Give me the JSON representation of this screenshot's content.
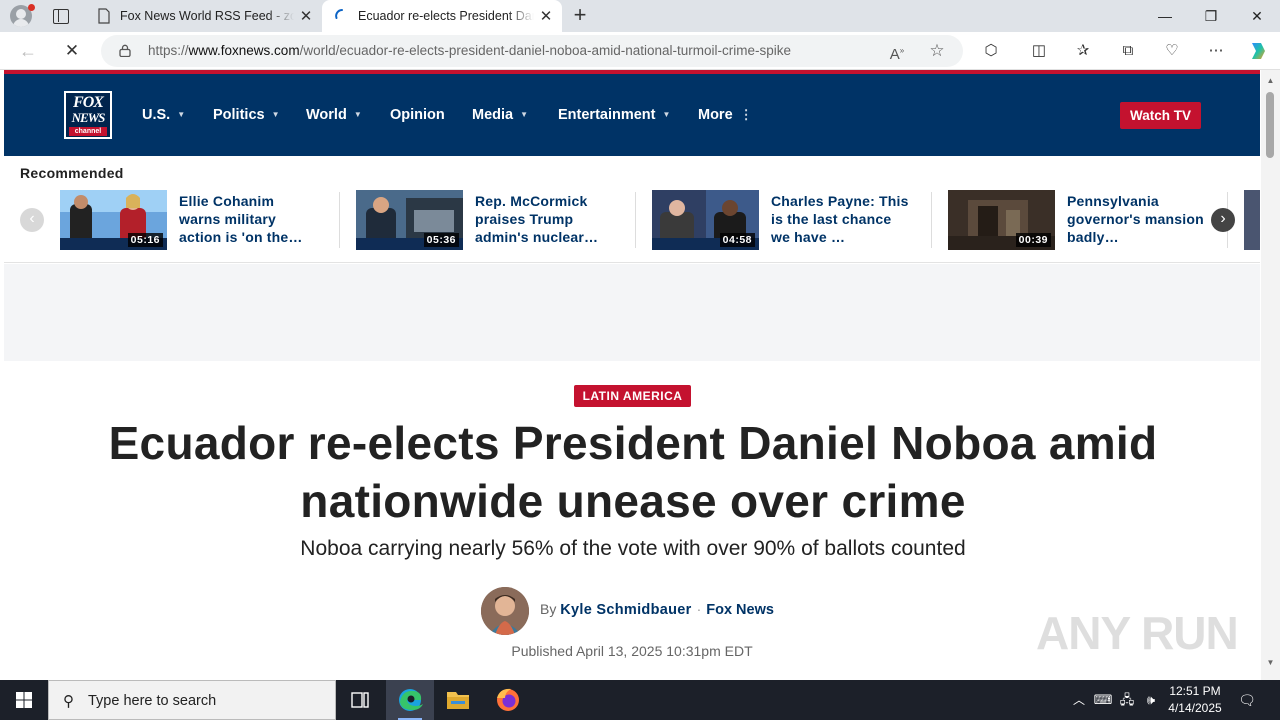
{
  "browser": {
    "tabs": [
      {
        "title": "Fox News World RSS Feed - zovel"
      },
      {
        "title": "Ecuador re-elects President Daniel Noboa"
      }
    ],
    "url_prefix": "https://",
    "url_host": "www.foxnews.com",
    "url_path": "/world/ecuador-re-elects-president-daniel-noboa-amid-national-turmoil-crime-spike"
  },
  "site": {
    "logo_line1": "FOX",
    "logo_line2": "NEWS",
    "logo_line3": "channel",
    "nav": [
      {
        "label": "U.S."
      },
      {
        "label": "Politics"
      },
      {
        "label": "World"
      },
      {
        "label": "Opinion"
      },
      {
        "label": "Media"
      },
      {
        "label": "Entertainment"
      },
      {
        "label": "More"
      }
    ],
    "watch_label": "Watch TV"
  },
  "recommended": {
    "heading": "Recommended",
    "items": [
      {
        "title": "Ellie Cohanim warns military action is 'on the…",
        "duration": "05:16"
      },
      {
        "title": "Rep. McCormick praises Trump admin's nuclear…",
        "duration": "05:36"
      },
      {
        "title": "Charles Payne: This is the last chance we have …",
        "duration": "04:58"
      },
      {
        "title": "Pennsylvania governor's mansion badly…",
        "duration": "00:39"
      }
    ]
  },
  "article": {
    "kicker": "LATIN AMERICA",
    "headline": "Ecuador re-elects President Daniel Noboa amid nationwide unease over crime",
    "subhead": "Noboa carrying nearly 56% of the vote with over 90% of ballots counted",
    "by": "By",
    "author": "Kyle Schmidbauer",
    "outlet": "Fox News",
    "published": "Published April 13, 2025 10:31pm EDT"
  },
  "watermark": "ANY RUN",
  "taskbar": {
    "search_placeholder": "Type here to search",
    "time": "12:51 PM",
    "date": "4/14/2025"
  },
  "colors": {
    "fox_navy": "#003366",
    "fox_red": "#c4122f"
  }
}
